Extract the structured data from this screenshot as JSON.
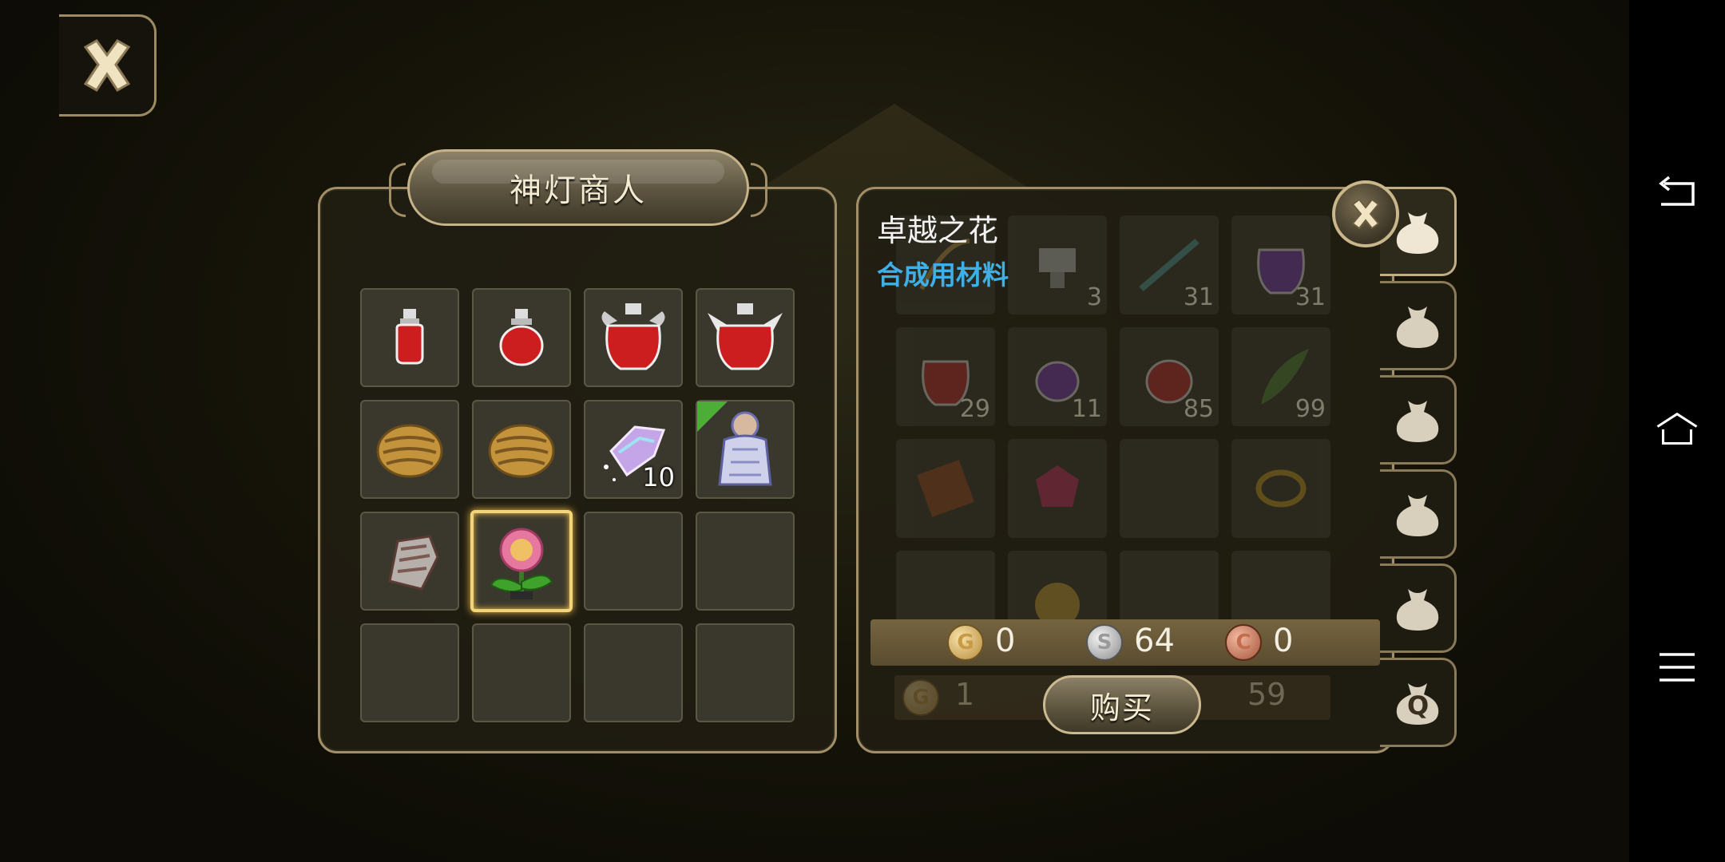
{
  "shop": {
    "title": "神灯商人",
    "slots": [
      {
        "item": "small-red-potion",
        "qty": ""
      },
      {
        "item": "red-potion",
        "qty": ""
      },
      {
        "item": "large-red-potion",
        "qty": ""
      },
      {
        "item": "winged-red-potion",
        "qty": ""
      },
      {
        "item": "golden-gauntlet",
        "qty": ""
      },
      {
        "item": "golden-gauntlet",
        "qty": ""
      },
      {
        "item": "crystal-shard",
        "qty": "10"
      },
      {
        "item": "robed-figure",
        "qty": "",
        "new": true
      },
      {
        "item": "steel-gauntlet",
        "qty": ""
      },
      {
        "item": "pink-flower",
        "qty": "",
        "selected": true
      },
      {
        "item": "empty",
        "qty": ""
      },
      {
        "item": "empty",
        "qty": ""
      },
      {
        "item": "empty",
        "qty": ""
      },
      {
        "item": "empty",
        "qty": ""
      },
      {
        "item": "empty",
        "qty": ""
      },
      {
        "item": "empty",
        "qty": ""
      }
    ]
  },
  "detail": {
    "name": "卓越之花",
    "type": "合成用材料",
    "currency": {
      "gold": "0",
      "silver": "64",
      "copper": "0"
    },
    "coin_letters": {
      "gold": "G",
      "silver": "S",
      "copper": "C"
    },
    "buy_label": "购买"
  },
  "inventory_bg": {
    "slots": [
      {
        "item": "bow",
        "qty": ""
      },
      {
        "item": "anvil",
        "qty": "3"
      },
      {
        "item": "dark-branch",
        "qty": "31"
      },
      {
        "item": "purple-potion",
        "qty": "31"
      },
      {
        "item": "red-potion",
        "qty": "29"
      },
      {
        "item": "purple-potion",
        "qty": "11"
      },
      {
        "item": "red-potion",
        "qty": "85"
      },
      {
        "item": "herb",
        "qty": "99"
      },
      {
        "item": "book",
        "qty": ""
      },
      {
        "item": "red-gem",
        "qty": ""
      },
      {
        "item": "empty",
        "qty": ""
      },
      {
        "item": "gold-ring",
        "qty": ""
      },
      {
        "item": "empty",
        "qty": ""
      },
      {
        "item": "golden-apple",
        "qty": ""
      },
      {
        "item": "empty",
        "qty": ""
      },
      {
        "item": "empty",
        "qty": ""
      }
    ],
    "gold": "1",
    "silver": "59"
  },
  "bag_tabs": [
    "bag-icon",
    "bag-icon",
    "bag-icon",
    "bag-icon",
    "bag-icon",
    "quest-bag-icon"
  ],
  "quest_tab_letter": "Q",
  "colors": {
    "panel_border": "#a28f68",
    "selected": "#f3d479",
    "type_text": "#3fb0e6"
  }
}
